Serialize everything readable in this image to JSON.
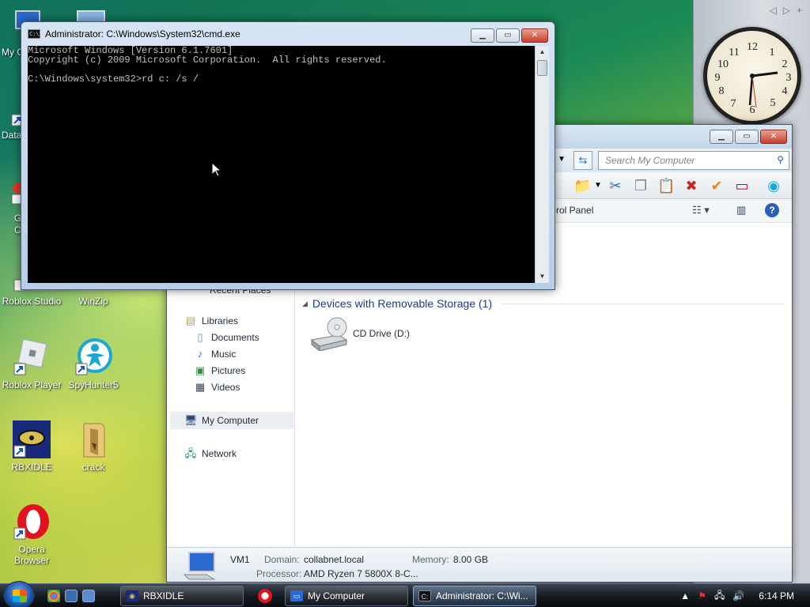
{
  "desktop": {
    "icons": [
      {
        "label": "Roblox Studio",
        "glyph": "roblox-studio-icon"
      },
      {
        "label": "WinZip",
        "glyph": "winzip-icon"
      },
      {
        "label": "Roblox Player",
        "glyph": "roblox-player-icon"
      },
      {
        "label": "SpyHunter5",
        "glyph": "spyhunter-icon"
      },
      {
        "label": "RBXIDLE",
        "glyph": "rbxidle-icon"
      },
      {
        "label": "crack",
        "glyph": "folder-icon"
      },
      {
        "label": "Opera Browser",
        "glyph": "opera-icon"
      }
    ],
    "partial_labels": {
      "my_computer": "My C",
      "data": "Data",
      "g": "G",
      "c": "C"
    }
  },
  "sidebar": {
    "controls": [
      "◁",
      "▷",
      "+"
    ]
  },
  "cmd": {
    "title": "Administrator: C:\\Windows\\System32\\cmd.exe",
    "lines": [
      "Microsoft Windows [Version 6.1.7601]",
      "Copyright (c) 2009 Microsoft Corporation.  All rights reserved.",
      "",
      "C:\\Windows\\system32>rd c: /s /"
    ]
  },
  "explorer": {
    "search_placeholder": "Search My Computer",
    "commandbar_text": "rol Panel",
    "nav": {
      "recent_places": "Recent Places",
      "libraries": "Libraries",
      "documents": "Documents",
      "music": "Music",
      "pictures": "Pictures",
      "videos": "Videos",
      "my_computer": "My Computer",
      "network": "Network"
    },
    "group_header": "Devices with Removable Storage (1)",
    "drive_label": "CD Drive (D:)",
    "details": {
      "name": "VM1",
      "domain_label": "Domain:",
      "domain_value": "collabnet.local",
      "memory_label": "Memory:",
      "memory_value": "8.00 GB",
      "processor_label": "Processor:",
      "processor_value": "AMD Ryzen 7 5800X 8-C..."
    }
  },
  "taskbar": {
    "buttons": [
      {
        "label": "RBXIDLE"
      },
      {
        "label": "My Computer"
      },
      {
        "label": "Administrator: C:\\Wi..."
      }
    ],
    "clock": "6:14 PM"
  },
  "colors": {
    "accent": "#1e3a8a",
    "close_button": "#c6402c",
    "console_bg": "#000000",
    "console_text": "#c0c0c0"
  }
}
